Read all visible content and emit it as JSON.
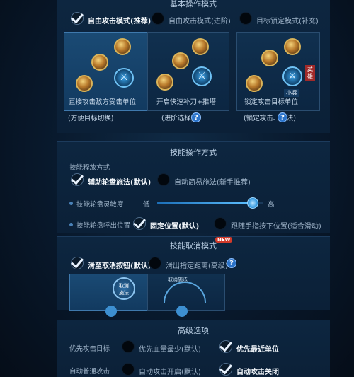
{
  "basic": {
    "title": "基本操作模式",
    "options": [
      {
        "label": "自由攻击模式(推荐)",
        "checked": true
      },
      {
        "label": "自由攻击模式(进阶)",
        "checked": false
      },
      {
        "label": "目标锁定模式(补充)",
        "checked": false
      }
    ],
    "cards": [
      {
        "line1": "直接攻击敌方受击单位",
        "line2": "(方便目标切换)"
      },
      {
        "line1": "开启快速补刀+推塔",
        "line2": "(进阶选择)"
      },
      {
        "line1": "锁定攻击目标单位",
        "line2": "(锁定攻击、施法)"
      }
    ],
    "minion_badge": "小兵",
    "hero_badge": "英雄"
  },
  "skill_op": {
    "title": "技能操作方式",
    "release_label": "技能释放方式",
    "release_options": [
      {
        "label": "辅助轮盘施法(默认)",
        "checked": true
      },
      {
        "label": "自动简易施法(新手推荐)",
        "checked": false
      }
    ],
    "sensitivity_label": "技能轮盘灵敏度",
    "low": "低",
    "high": "高",
    "sensitivity_value": 0.9,
    "position_label": "技能轮盘呼出位置",
    "position_options": [
      {
        "label": "固定位置(默认)",
        "checked": true
      },
      {
        "label": "跟随手指按下位置(适合滑动)",
        "checked": false
      }
    ]
  },
  "cancel": {
    "title": "技能取消模式",
    "new_badge": "NEW",
    "options": [
      {
        "label": "滑至取消按钮(默认)",
        "checked": true
      },
      {
        "label": "滑出指定距离(高级)",
        "checked": false
      }
    ],
    "cancel_btn": "取消施法",
    "cancel_arc": "取消施法"
  },
  "advanced": {
    "title": "高级选项",
    "rows": [
      {
        "label": "优先攻击目标",
        "options": [
          {
            "label": "优先血量最少(默认)",
            "checked": false
          },
          {
            "label": "优先最近单位",
            "checked": true
          }
        ]
      },
      {
        "label": "自动普通攻击",
        "options": [
          {
            "label": "自动攻击开启(默认)",
            "checked": false
          },
          {
            "label": "自动攻击关闭",
            "checked": true
          }
        ]
      }
    ]
  },
  "help_icon": "?",
  "colors": {
    "accent": "#2b73c9",
    "panel": "#0d2640",
    "highlight_card": "#1a4a74"
  }
}
